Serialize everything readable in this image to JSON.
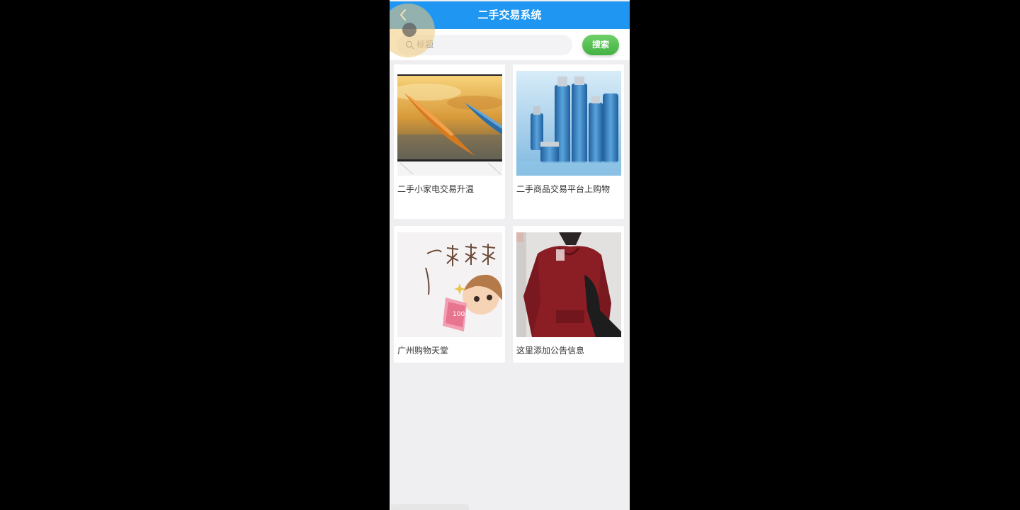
{
  "app": {
    "title": "二手交易系统"
  },
  "search": {
    "placeholder": "标题",
    "button_label": "搜索"
  },
  "items": [
    {
      "label": "二手小家电交易升温",
      "image": "kayak-photo"
    },
    {
      "label": "二手商品交易平台上购物",
      "image": "cosmetics-bottles-photo"
    },
    {
      "label": "广州购物天堂",
      "image": "cartoon-shopping-illustration"
    },
    {
      "label": "这里添加公告信息",
      "image": "red-hoodie-photo"
    }
  ],
  "colors": {
    "header": "#1f96f2",
    "search_button": "#4cb848",
    "background": "#efeff1"
  }
}
